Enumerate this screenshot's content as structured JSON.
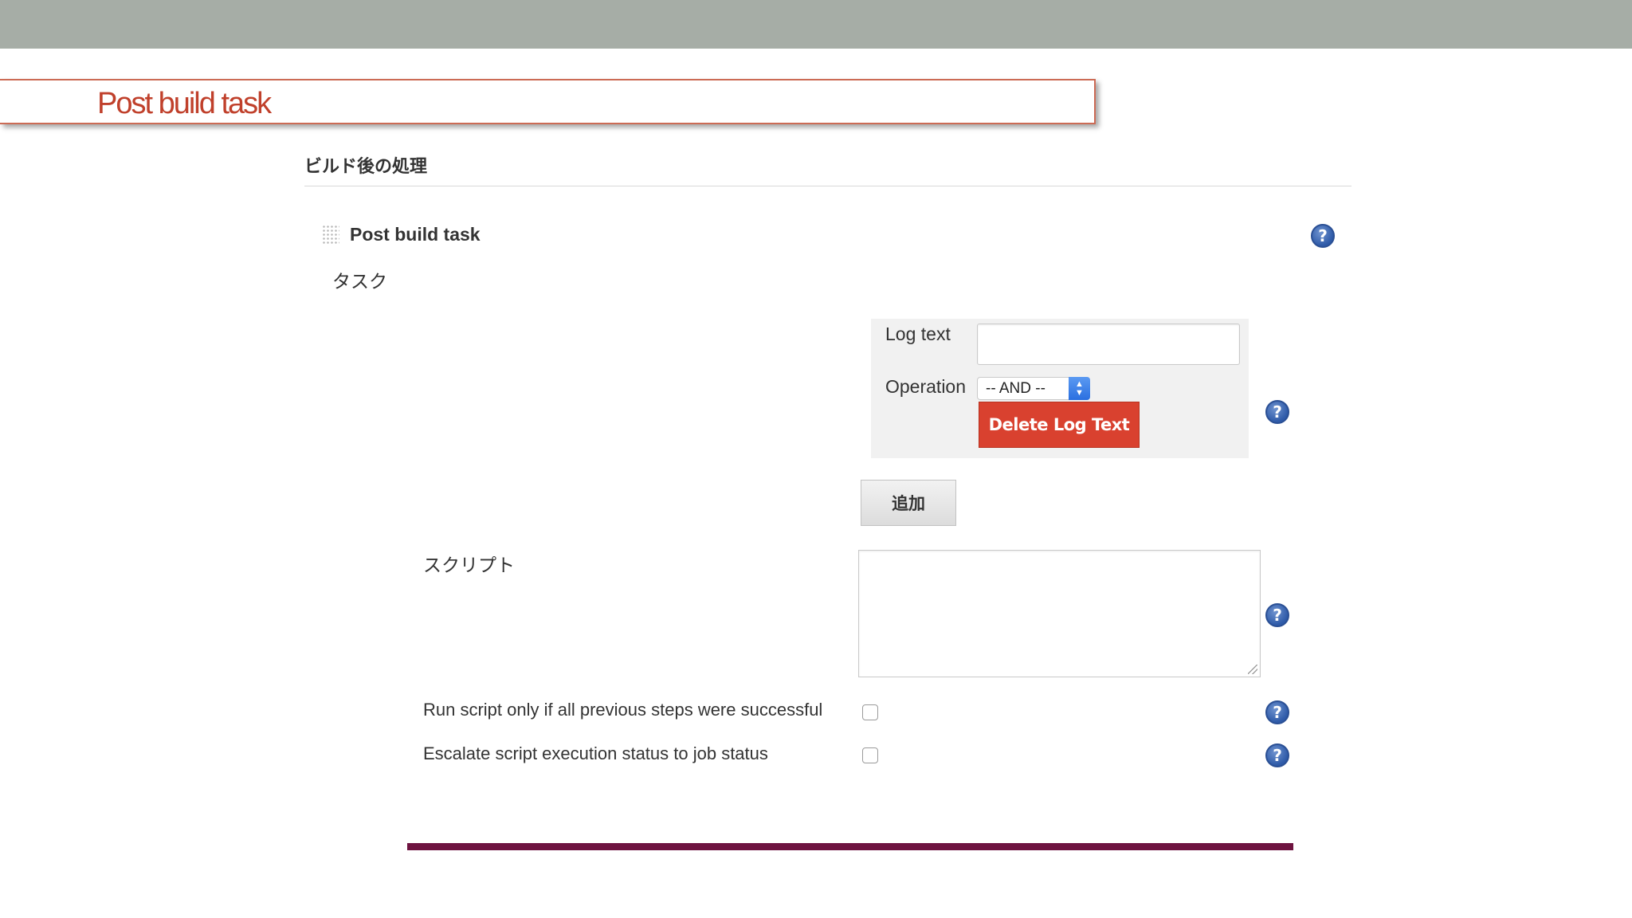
{
  "slide": {
    "title": "Post build task"
  },
  "section": {
    "heading": "ビルド後の処理"
  },
  "block": {
    "title": "Post build task",
    "help": "?"
  },
  "task": {
    "label": "タスク",
    "log_text_label": "Log text",
    "log_text_value": "",
    "operation_label": "Operation",
    "operation_value": "-- AND --",
    "delete_button": "Delete Log Text",
    "help": "?"
  },
  "add_button": "追加",
  "script": {
    "label": "スクリプト",
    "value": "",
    "help": "?"
  },
  "options": [
    {
      "label": "Run script only if all previous steps were successful",
      "checked": false,
      "help": "?"
    },
    {
      "label": "Escalate script execution status to job status",
      "checked": false,
      "help": "?"
    }
  ],
  "colors": {
    "title_red": "#c0402b",
    "delete_red": "#d9412f",
    "help_blue": "#2e5aa8",
    "bottom_bar": "#6e1340",
    "top_bar": "#a6ada6"
  },
  "icons": {
    "help": "question-mark-circle-icon",
    "drag": "drag-handle-icon",
    "select": "up-down-arrows-icon"
  }
}
